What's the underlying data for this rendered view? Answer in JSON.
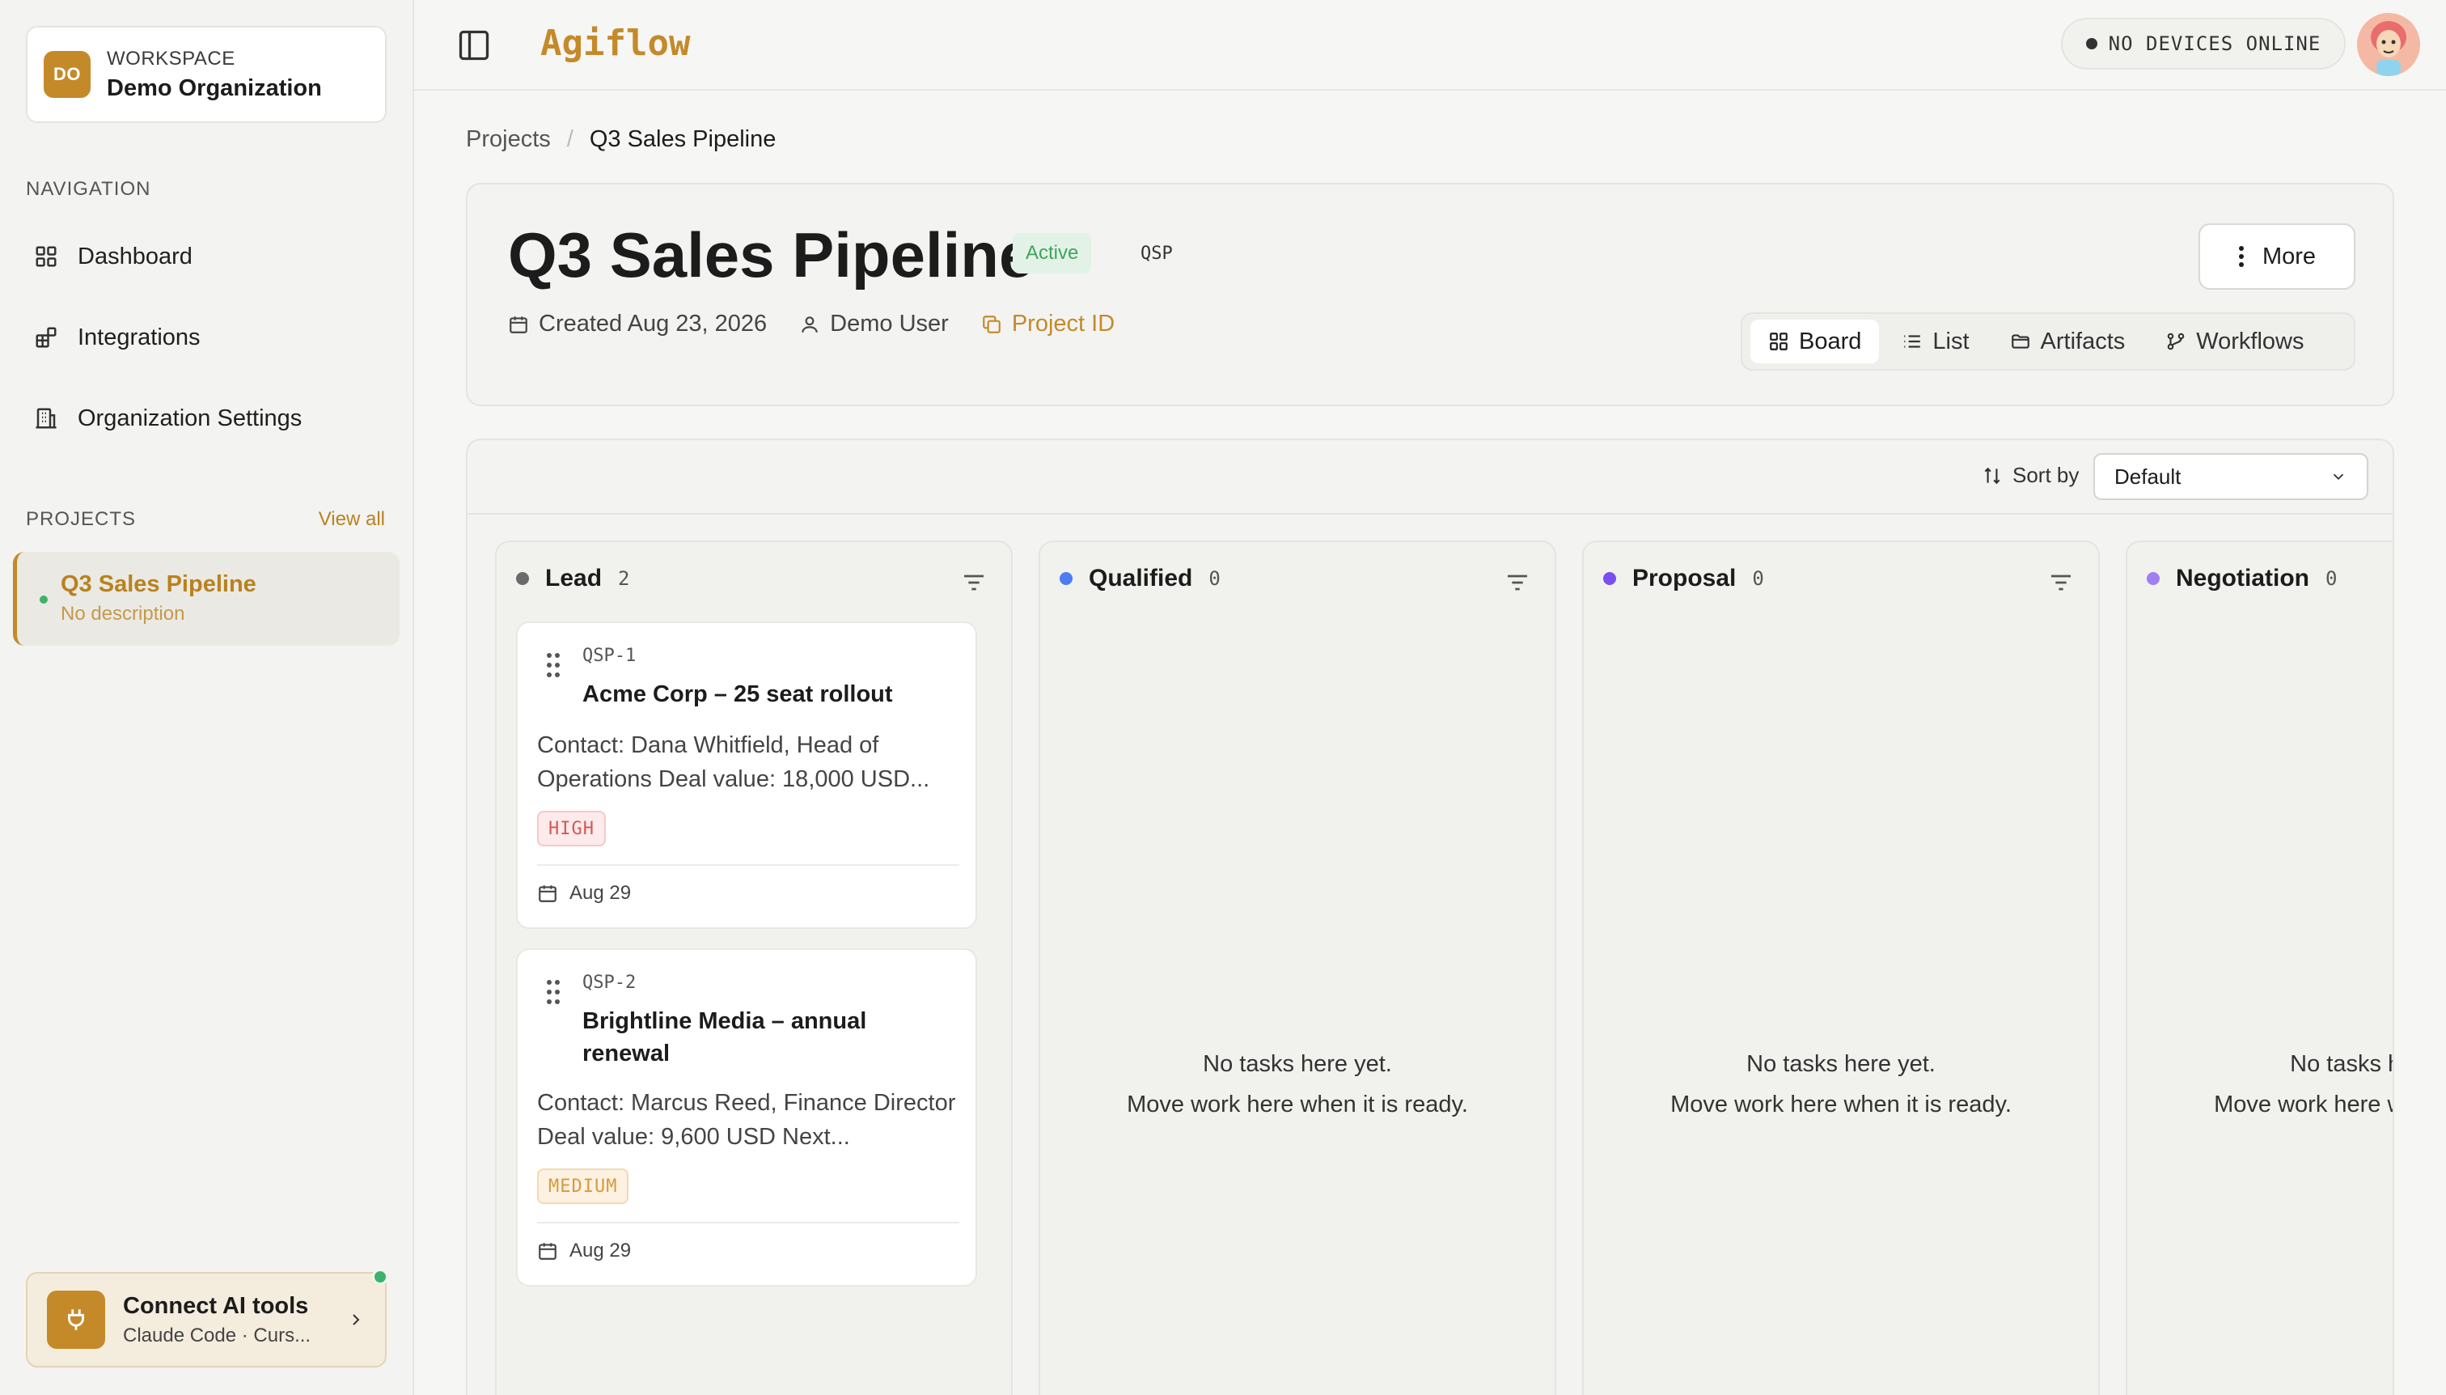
{
  "workspace": {
    "initials": "DO",
    "label": "WORKSPACE",
    "name": "Demo Organization"
  },
  "navigation": {
    "title": "NAVIGATION",
    "items": [
      {
        "label": "Dashboard",
        "icon": "grid-icon"
      },
      {
        "label": "Integrations",
        "icon": "puzzle-icon"
      },
      {
        "label": "Organization Settings",
        "icon": "building-icon"
      }
    ]
  },
  "projects_section": {
    "title": "PROJECTS",
    "view_all": "View all",
    "items": [
      {
        "name": "Q3 Sales Pipeline",
        "description": "No description"
      }
    ]
  },
  "connect": {
    "title": "Connect AI tools",
    "subtitle": "Claude Code · Curs..."
  },
  "topbar": {
    "logo": "Agiflow",
    "devices": "NO DEVICES ONLINE"
  },
  "breadcrumb": {
    "parent": "Projects",
    "separator": "/",
    "current": "Q3 Sales Pipeline"
  },
  "project": {
    "title": "Q3 Sales Pipeline",
    "status": "Active",
    "key": "QSP",
    "created": "Created Aug 23, 2026",
    "owner": "Demo User",
    "project_id_label": "Project ID",
    "more_label": "More",
    "views": [
      {
        "label": "Board",
        "icon": "board-icon",
        "active": true
      },
      {
        "label": "List",
        "icon": "list-icon",
        "active": false
      },
      {
        "label": "Artifacts",
        "icon": "folder-icon",
        "active": false
      },
      {
        "label": "Workflows",
        "icon": "workflow-icon",
        "active": false
      }
    ]
  },
  "board": {
    "sort_label": "Sort by",
    "sort_value": "Default",
    "empty_line1": "No tasks here yet.",
    "empty_line2": "Move work here when it is ready.",
    "columns": [
      {
        "name": "Lead",
        "count": "2",
        "color": "#6b6b6b"
      },
      {
        "name": "Qualified",
        "count": "0",
        "color": "#4f7cf0"
      },
      {
        "name": "Proposal",
        "count": "0",
        "color": "#7a4ff0"
      },
      {
        "name": "Negotiation",
        "count": "0",
        "color": "#a07ff0"
      }
    ],
    "tasks": [
      {
        "key": "QSP-1",
        "title": "Acme Corp – 25 seat rollout",
        "description": "Contact: Dana Whitfield, Head of Operations Deal value: 18,000 USD...",
        "priority": "HIGH",
        "date": "Aug 29"
      },
      {
        "key": "QSP-2",
        "title": "Brightline Media – annual renewal",
        "description": "Contact: Marcus Reed, Finance Director Deal value: 9,600 USD Next...",
        "priority": "MEDIUM",
        "date": "Aug 29"
      }
    ]
  }
}
